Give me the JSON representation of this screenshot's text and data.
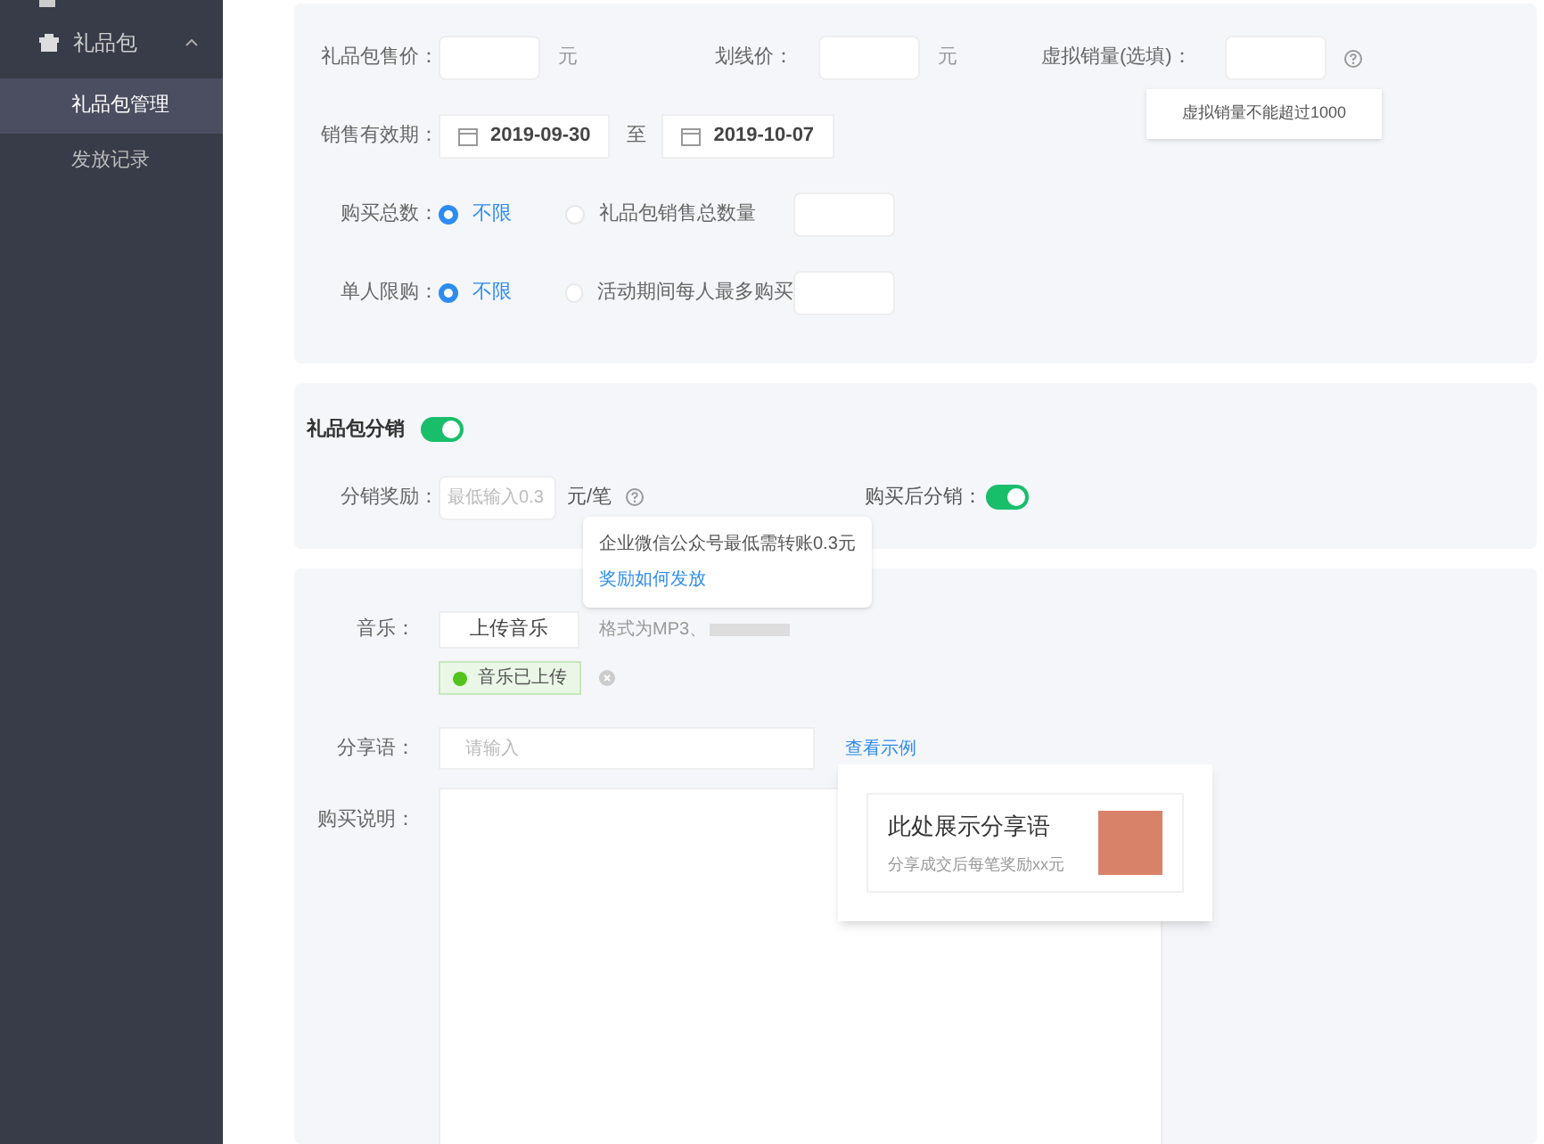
{
  "sidebar": {
    "items": [
      {
        "label": "礼品包",
        "expanded": true,
        "children": [
          {
            "label": "礼品包管理",
            "selected": true
          },
          {
            "label": "发放记录",
            "selected": false
          }
        ]
      }
    ]
  },
  "pricing": {
    "price_label": "礼品包售价：",
    "price_unit": "元",
    "strike_label": "划线价：",
    "strike_unit": "元",
    "virtual_label": "虚拟销量(选填)：",
    "virtual_tooltip": "虚拟销量不能超过1000",
    "period_label": "销售有效期：",
    "start_date": "2019-09-30",
    "to": "至",
    "end_date": "2019-10-07",
    "limits": [
      {
        "label": "购买总数：",
        "options": [
          {
            "label": "不限",
            "selected": true
          },
          {
            "label": "礼品包销售总数量",
            "selected": false
          }
        ]
      },
      {
        "label": "单人限购：",
        "options": [
          {
            "label": "不限",
            "selected": true
          },
          {
            "label": "活动期间每人最多购买",
            "selected": false
          }
        ]
      }
    ]
  },
  "distribution": {
    "title": "礼品包分销",
    "on": true,
    "reward_label": "分销奖励：",
    "reward_placeholder": "最低输入0.3",
    "reward_unit": "元/笔",
    "after_label": "购买后分销：",
    "after_on": true,
    "tooltip": {
      "text": "企业微信公众号最低需转账0.3元",
      "link": "奖励如何发放"
    }
  },
  "content": {
    "music_label": "音乐：",
    "upload_button": "上传音乐",
    "format_hint": "格式为MP3、",
    "uploaded_tag": "音乐已上传",
    "share_label": "分享语：",
    "share_placeholder": "请输入",
    "example_link": "查看示例",
    "example": {
      "title": "此处展示分享语",
      "subtitle": "分享成交后每笔奖励xx元"
    },
    "desc_label": "购买说明："
  }
}
